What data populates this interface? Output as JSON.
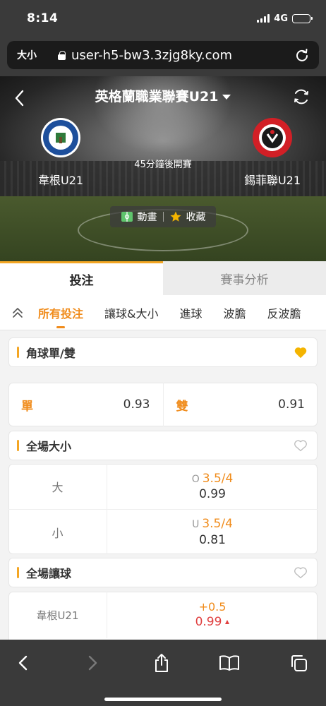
{
  "status_bar": {
    "time": "8:14",
    "network": "4G",
    "battery_level": 0.28
  },
  "url_bar": {
    "text_size_label": "大小",
    "url": "user-h5-bw3.3zjg8ky.com"
  },
  "match": {
    "league": "英格蘭職業聯賽U21",
    "home_team": "韋根U21",
    "away_team": "錫菲聯U21",
    "kickoff": "45分鐘後開賽",
    "actions": {
      "animation": "動畫",
      "favorite": "收藏"
    }
  },
  "main_tabs": [
    {
      "label": "投注",
      "active": true
    },
    {
      "label": "賽事分析",
      "active": false
    }
  ],
  "sub_tabs": [
    {
      "label": "所有投注",
      "active": true
    },
    {
      "label": "讓球&大小",
      "active": false
    },
    {
      "label": "進球",
      "active": false
    },
    {
      "label": "波膽",
      "active": false
    },
    {
      "label": "反波膽",
      "active": false
    }
  ],
  "markets": {
    "odd_even": {
      "title": "角球單/雙",
      "favorited": true,
      "odd": {
        "label": "單",
        "price": "0.93"
      },
      "even": {
        "label": "雙",
        "price": "0.91"
      }
    },
    "over_under": {
      "title": "全場大小",
      "favorited": false,
      "rows": [
        {
          "label": "大",
          "side": "O",
          "line": "3.5/4",
          "price": "0.99"
        },
        {
          "label": "小",
          "side": "U",
          "line": "3.5/4",
          "price": "0.81"
        }
      ]
    },
    "handicap": {
      "title": "全場讓球",
      "favorited": false,
      "rows": [
        {
          "label": "韋根U21",
          "line": "+0.5",
          "price": "0.99",
          "trend": "up"
        }
      ]
    }
  },
  "colors": {
    "accent": "#f08c1c",
    "gold": "#f4a623",
    "price_up": "#e04040"
  }
}
